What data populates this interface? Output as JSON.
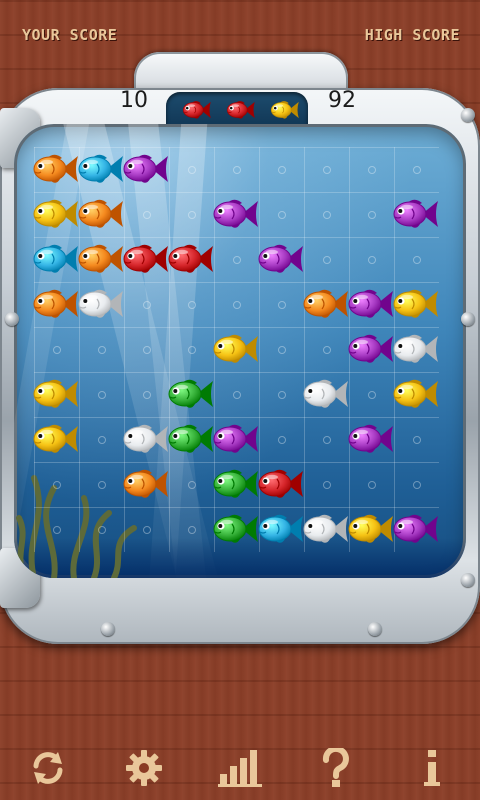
{
  "header": {
    "your_score_label": "YOUR SCORE",
    "high_score_label": "HIGH SCORE"
  },
  "scores": {
    "current": "10",
    "high": "92"
  },
  "next_fish": [
    "red",
    "red",
    "yellow"
  ],
  "board": {
    "rows": 9,
    "cols": 9,
    "cells": [
      [
        "orange",
        "cyan",
        "purple",
        null,
        null,
        null,
        null,
        null,
        null
      ],
      [
        "yellow",
        "orange",
        null,
        null,
        "purple",
        null,
        null,
        null,
        "purple"
      ],
      [
        "cyan",
        "orange",
        "red",
        "red",
        null,
        "purple",
        null,
        null,
        null
      ],
      [
        "orange",
        "white",
        null,
        null,
        null,
        null,
        "orange",
        "purple",
        "yellow"
      ],
      [
        null,
        null,
        null,
        null,
        "yellow",
        null,
        null,
        "purple",
        "white"
      ],
      [
        "yellow",
        null,
        null,
        "green",
        null,
        null,
        "white",
        null,
        "yellow"
      ],
      [
        "yellow",
        null,
        "white",
        "green",
        "purple",
        null,
        null,
        "purple",
        null
      ],
      [
        null,
        null,
        "orange",
        null,
        "green",
        "red",
        null,
        null,
        null
      ],
      [
        null,
        null,
        null,
        null,
        "green",
        "cyan",
        "white",
        "yellow",
        "purple"
      ]
    ]
  },
  "colors": {
    "orange": "#f58a1f",
    "cyan": "#35b5e6",
    "purple": "#a83bc4",
    "yellow": "#f6c214",
    "red": "#d6262b",
    "white": "#e9ecef",
    "green": "#37b23a",
    "label": "#e9c79a",
    "toolbar_icon": "#e9c79a"
  },
  "toolbar": {
    "icons": [
      "restart-icon",
      "settings-icon",
      "leaderboard-icon",
      "help-icon",
      "info-icon"
    ]
  }
}
